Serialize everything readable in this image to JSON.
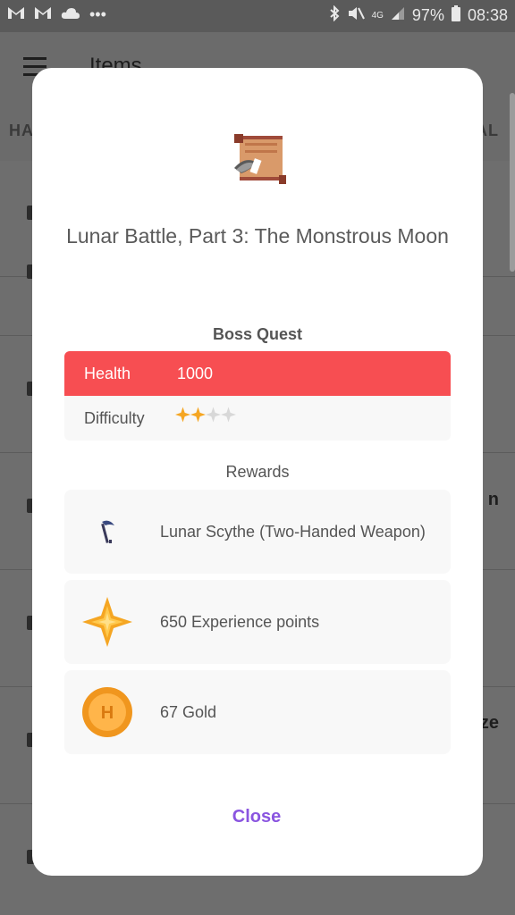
{
  "status_bar": {
    "battery": "97%",
    "time": "08:38",
    "network": "4G"
  },
  "background": {
    "title": "Items",
    "tab_left": "HA",
    "tab_right": "AL",
    "edge_text_1": "n",
    "edge_text_2": "ze"
  },
  "dialog": {
    "quest_title": "Lunar Battle, Part 3: The Monstrous Moon",
    "boss_section": "Boss Quest",
    "health_label": "Health",
    "health_value": "1000",
    "difficulty_label": "Difficulty",
    "difficulty_stars": 2,
    "difficulty_max": 4,
    "rewards_section": "Rewards",
    "rewards": [
      {
        "icon": "scythe-icon",
        "label": "Lunar Scythe (Two-Handed Weapon)"
      },
      {
        "icon": "experience-star-icon",
        "label": "650 Experience points"
      },
      {
        "icon": "gold-coin-icon",
        "label": "67 Gold"
      }
    ],
    "close_label": "Close"
  },
  "colors": {
    "health_red": "#f74e52",
    "accent_purple": "#8a55e0",
    "star_gold": "#f5a623",
    "overlay": "#6b6b6b"
  }
}
